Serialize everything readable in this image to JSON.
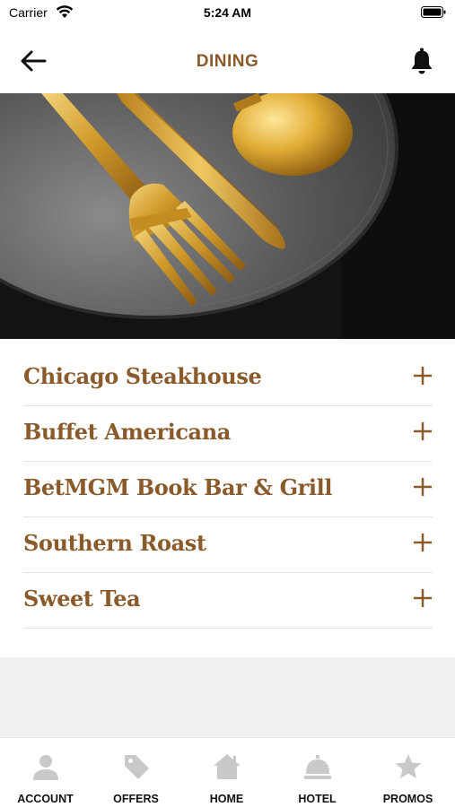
{
  "status_bar": {
    "carrier": "Carrier",
    "time": "5:24 AM"
  },
  "header": {
    "title": "DINING"
  },
  "hero": {
    "image": "gold-cutlery-on-dark-plate"
  },
  "colors": {
    "accent": "#8a5a2b",
    "tab_icon": "#c9c9c9",
    "divider": "#e6e6e6",
    "footer_gray": "#f0f0f0"
  },
  "dining": {
    "items": [
      {
        "name": "Chicago Steakhouse",
        "icon": "plus-icon"
      },
      {
        "name": "Buffet Americana",
        "icon": "plus-icon"
      },
      {
        "name": "BetMGM Book Bar & Grill",
        "icon": "plus-icon"
      },
      {
        "name": "Southern Roast",
        "icon": "plus-icon"
      },
      {
        "name": "Sweet Tea",
        "icon": "plus-icon"
      }
    ]
  },
  "tabs": [
    {
      "label": "ACCOUNT",
      "icon": "person-icon"
    },
    {
      "label": "OFFERS",
      "icon": "tag-icon"
    },
    {
      "label": "HOME",
      "icon": "house-icon"
    },
    {
      "label": "HOTEL",
      "icon": "service-bell-icon"
    },
    {
      "label": "PROMOS",
      "icon": "star-icon"
    }
  ]
}
